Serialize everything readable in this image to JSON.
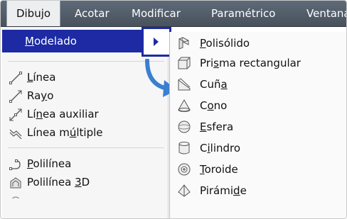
{
  "menubar": {
    "items": [
      "Dibujo",
      "Acotar",
      "Modificar",
      "Paramétrico",
      "Ventana"
    ]
  },
  "left_menu": {
    "highlighted": {
      "pre": "",
      "u": "M",
      "post": "odelado"
    },
    "items": [
      {
        "pre": "",
        "u": "L",
        "post": "ínea",
        "icon": "line-icon"
      },
      {
        "pre": "Ra",
        "u": "y",
        "post": "o",
        "icon": "ray-icon"
      },
      {
        "pre": "Lí",
        "u": "n",
        "post": "ea auxiliar",
        "icon": "construction-line-icon"
      },
      {
        "pre": "Línea m",
        "u": "ú",
        "post": "ltiple",
        "icon": "multiline-icon"
      },
      {
        "pre": "",
        "u": "P",
        "post": "olilínea",
        "icon": "polyline-icon"
      },
      {
        "pre": "Polilínea ",
        "u": "3",
        "post": "D",
        "icon": "3d-polyline-icon"
      }
    ]
  },
  "right_menu": {
    "items": [
      {
        "pre": "",
        "u": "P",
        "post": "olisólido",
        "icon": "polysolid-icon"
      },
      {
        "pre": "Pri",
        "u": "s",
        "post": "ma rectangular",
        "icon": "box-icon"
      },
      {
        "pre": "Cuñ",
        "u": "a",
        "post": "",
        "icon": "wedge-icon"
      },
      {
        "pre": "C",
        "u": "o",
        "post": "no",
        "icon": "cone-icon"
      },
      {
        "pre": "",
        "u": "E",
        "post": "sfera",
        "icon": "sphere-icon"
      },
      {
        "pre": "C",
        "u": "i",
        "post": "lindro",
        "icon": "cylinder-icon"
      },
      {
        "pre": "",
        "u": "T",
        "post": "oroide",
        "icon": "torus-icon"
      },
      {
        "pre": "Pirámi",
        "u": "d",
        "post": "e",
        "icon": "pyramid-icon"
      }
    ]
  },
  "colors": {
    "highlight": "#1d2aa3",
    "menubar": "#525c67",
    "annotation_arrow": "#3a7fd0"
  }
}
